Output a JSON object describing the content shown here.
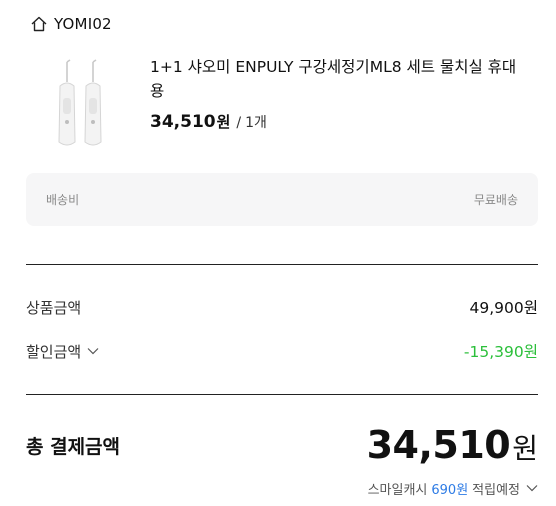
{
  "store": {
    "name": "YOMI02",
    "icon": "home-icon"
  },
  "product": {
    "name": "1+1 샤오미 ENPULY 구강세정기ML8 세트 물치실 휴대용",
    "price": "34,510",
    "currency": "원",
    "separator": "/",
    "quantity": "1개"
  },
  "shipping": {
    "label": "배송비",
    "value": "무료배송"
  },
  "summary": {
    "goods_label": "상품금액",
    "goods_value": "49,900원",
    "discount_label": "할인금액",
    "discount_value": "-15,390원"
  },
  "total": {
    "label": "총 결제금액",
    "amount": "34,510",
    "currency": "원"
  },
  "cashback": {
    "prefix": "스마일캐시",
    "points": "690원",
    "suffix": "적립예정"
  },
  "colors": {
    "discount": "#2bbf3a",
    "points": "#2d7be5",
    "ship_bg": "#f6f6f7"
  }
}
